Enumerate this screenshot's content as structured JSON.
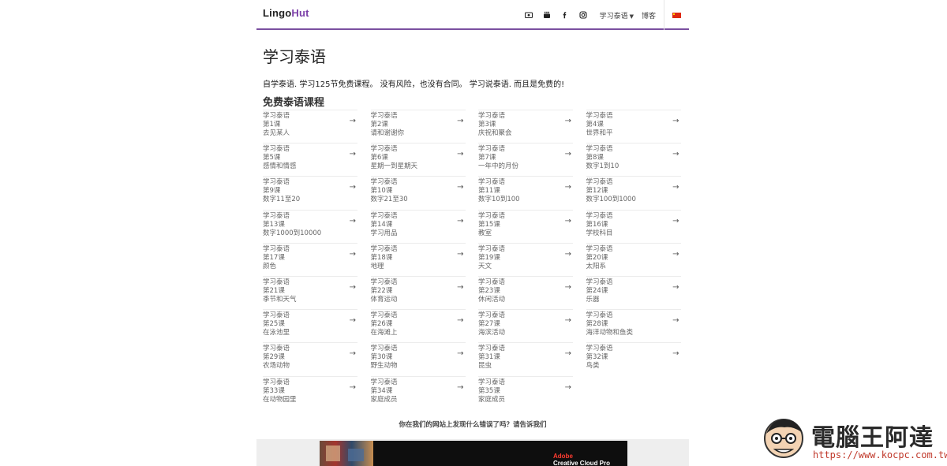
{
  "header": {
    "logo_part1": "Lingo",
    "logo_part2": "Hut",
    "nav_icons": [
      "video-icon",
      "youtube-icon",
      "facebook-icon",
      "instagram-icon"
    ],
    "language_menu": "学习泰语",
    "blog_link": "博客",
    "flag_icon": "china-flag-icon"
  },
  "main": {
    "title": "学习泰语",
    "intro": "自学泰语. 学习125节免费课程。 没有风险，也没有合同。 学习说泰语. 而且是免费的!",
    "subtitle": "免费泰语课程",
    "arrow": "→",
    "lessons": [
      {
        "course": "学习泰语",
        "number": "第1课",
        "topic": "去见某人"
      },
      {
        "course": "学习泰语",
        "number": "第2课",
        "topic": "请和谢谢你"
      },
      {
        "course": "学习泰语",
        "number": "第3课",
        "topic": "庆祝和聚会"
      },
      {
        "course": "学习泰语",
        "number": "第4课",
        "topic": "世界和平"
      },
      {
        "course": "学习泰语",
        "number": "第5课",
        "topic": "感情和情感"
      },
      {
        "course": "学习泰语",
        "number": "第6课",
        "topic": "星期一到星期天"
      },
      {
        "course": "学习泰语",
        "number": "第7课",
        "topic": "一年中的月份"
      },
      {
        "course": "学习泰语",
        "number": "第8课",
        "topic": "数字1到10"
      },
      {
        "course": "学习泰语",
        "number": "第9课",
        "topic": "数字11至20"
      },
      {
        "course": "学习泰语",
        "number": "第10课",
        "topic": "数字21至30"
      },
      {
        "course": "学习泰语",
        "number": "第11课",
        "topic": "数字10到100"
      },
      {
        "course": "学习泰语",
        "number": "第12课",
        "topic": "数字100到1000"
      },
      {
        "course": "学习泰语",
        "number": "第13课",
        "topic": "数字1000到10000"
      },
      {
        "course": "学习泰语",
        "number": "第14课",
        "topic": "学习用品"
      },
      {
        "course": "学习泰语",
        "number": "第15课",
        "topic": "教室"
      },
      {
        "course": "学习泰语",
        "number": "第16课",
        "topic": "学校科目"
      },
      {
        "course": "学习泰语",
        "number": "第17课",
        "topic": "颜色"
      },
      {
        "course": "学习泰语",
        "number": "第18课",
        "topic": "地理"
      },
      {
        "course": "学习泰语",
        "number": "第19课",
        "topic": "天文"
      },
      {
        "course": "学习泰语",
        "number": "第20课",
        "topic": "太阳系"
      },
      {
        "course": "学习泰语",
        "number": "第21课",
        "topic": "季节和天气"
      },
      {
        "course": "学习泰语",
        "number": "第22课",
        "topic": "体育运动"
      },
      {
        "course": "学习泰语",
        "number": "第23课",
        "topic": "休闲活动"
      },
      {
        "course": "学习泰语",
        "number": "第24课",
        "topic": "乐器"
      },
      {
        "course": "学习泰语",
        "number": "第25课",
        "topic": "在泳池里"
      },
      {
        "course": "学习泰语",
        "number": "第26课",
        "topic": "在海滩上"
      },
      {
        "course": "学习泰语",
        "number": "第27课",
        "topic": "海滨活动"
      },
      {
        "course": "学习泰语",
        "number": "第28课",
        "topic": "海洋动物和鱼类"
      },
      {
        "course": "学习泰语",
        "number": "第29课",
        "topic": "农场动物"
      },
      {
        "course": "学习泰语",
        "number": "第30课",
        "topic": "野生动物"
      },
      {
        "course": "学习泰语",
        "number": "第31课",
        "topic": "昆虫"
      },
      {
        "course": "学习泰语",
        "number": "第32课",
        "topic": "鸟类"
      },
      {
        "course": "学习泰语",
        "number": "第33课",
        "topic": "在动物园里"
      },
      {
        "course": "学习泰语",
        "number": "第34课",
        "topic": "家庭成员"
      },
      {
        "course": "学习泰语",
        "number": "第35课",
        "topic": "家庭成员"
      }
    ]
  },
  "footer": {
    "report_text": "你在我们的网站上发现什么错误了吗？请告诉我们"
  },
  "ad": {
    "brand": "Adobe",
    "product": "Creative Cloud Pro"
  },
  "watermark": {
    "site_name": "電腦王阿達",
    "url": "https://www.kocpc.com.tw/"
  },
  "colors": {
    "accent": "#7b3fa8",
    "header_rule": "#7a4fa0",
    "text": "#333333",
    "muted": "#666666",
    "watermark_url": "#c0392b"
  }
}
